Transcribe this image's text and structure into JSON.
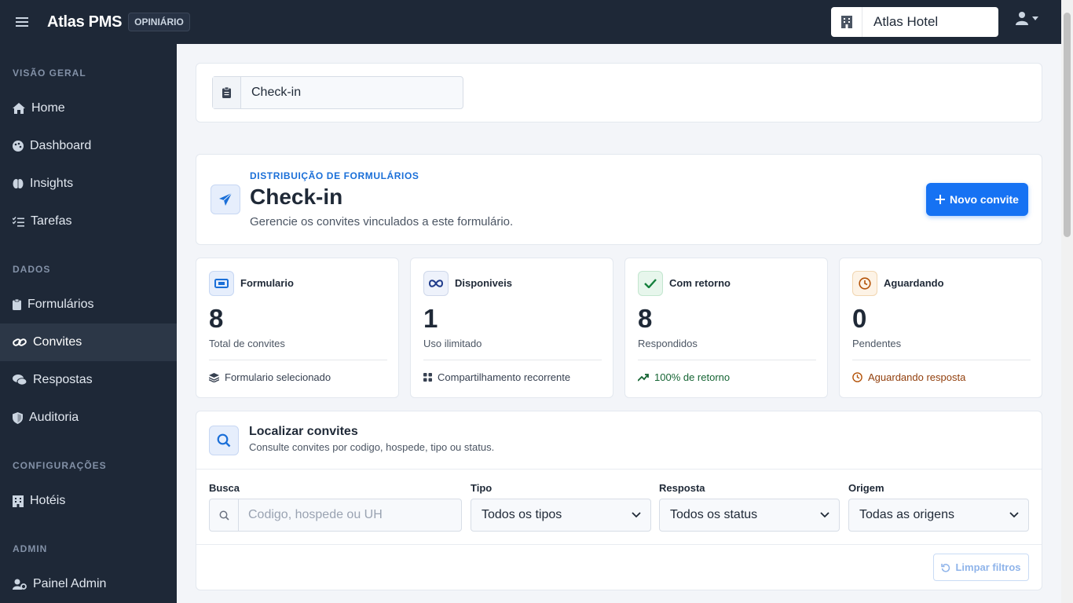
{
  "topbar": {
    "brand": "Atlas PMS",
    "badge": "OPINIÁRIO",
    "hotel": "Atlas Hotel"
  },
  "sidebar": {
    "sections": [
      {
        "label": "VISÃO GERAL"
      },
      {
        "label": "DADOS"
      },
      {
        "label": "CONFIGURAÇÕES"
      },
      {
        "label": "ADMIN"
      }
    ],
    "items": [
      {
        "label": "Home",
        "icon": "home-icon"
      },
      {
        "label": "Dashboard",
        "icon": "palette-icon"
      },
      {
        "label": "Insights",
        "icon": "brain-icon"
      },
      {
        "label": "Tarefas",
        "icon": "task-list-icon"
      },
      {
        "label": "Formulários",
        "icon": "clipboard-icon"
      },
      {
        "label": "Convites",
        "icon": "link-icon",
        "active": true
      },
      {
        "label": "Respostas",
        "icon": "comments-icon"
      },
      {
        "label": "Auditoria",
        "icon": "shield-icon"
      },
      {
        "label": "Hotéis",
        "icon": "building-icon"
      },
      {
        "label": "Painel Admin",
        "icon": "user-gear-icon"
      }
    ]
  },
  "form_selector": {
    "value": "Check-in"
  },
  "hero": {
    "eyebrow": "DISTRIBUIÇÃO DE FORMULÁRIOS",
    "title": "Check-in",
    "subtitle": "Gerencie os convites vinculados a este formulário.",
    "new_button": "Novo convite"
  },
  "stats": [
    {
      "label": "Formulario",
      "value": "8",
      "caption": "Total de convites",
      "footer": "Formulario selecionado",
      "icon": "ticket-icon",
      "accent": "#1a6fd8",
      "footer_color": "#374151"
    },
    {
      "label": "Disponiveis",
      "value": "1",
      "caption": "Uso ilimitado",
      "footer": "Compartilhamento recorrente",
      "icon": "infinity-icon",
      "accent": "#1e3a8a",
      "footer_color": "#374151"
    },
    {
      "label": "Com retorno",
      "value": "8",
      "caption": "Respondidos",
      "footer": "100% de retorno",
      "icon": "check-icon",
      "accent": "#15803d",
      "footer_color": "#166534"
    },
    {
      "label": "Aguardando",
      "value": "0",
      "caption": "Pendentes",
      "footer": "Aguardando resposta",
      "icon": "clock-icon",
      "accent": "#b45309",
      "footer_color": "#92400e"
    }
  ],
  "filters": {
    "title": "Localizar convites",
    "subtitle": "Consulte convites por codigo, hospede, tipo ou status.",
    "search_label": "Busca",
    "search_placeholder": "Codigo, hospede ou UH",
    "type_label": "Tipo",
    "type_value": "Todos os tipos",
    "response_label": "Resposta",
    "response_value": "Todos os status",
    "origin_label": "Origem",
    "origin_value": "Todas as origens",
    "clear_button": "Limpar filtros"
  }
}
